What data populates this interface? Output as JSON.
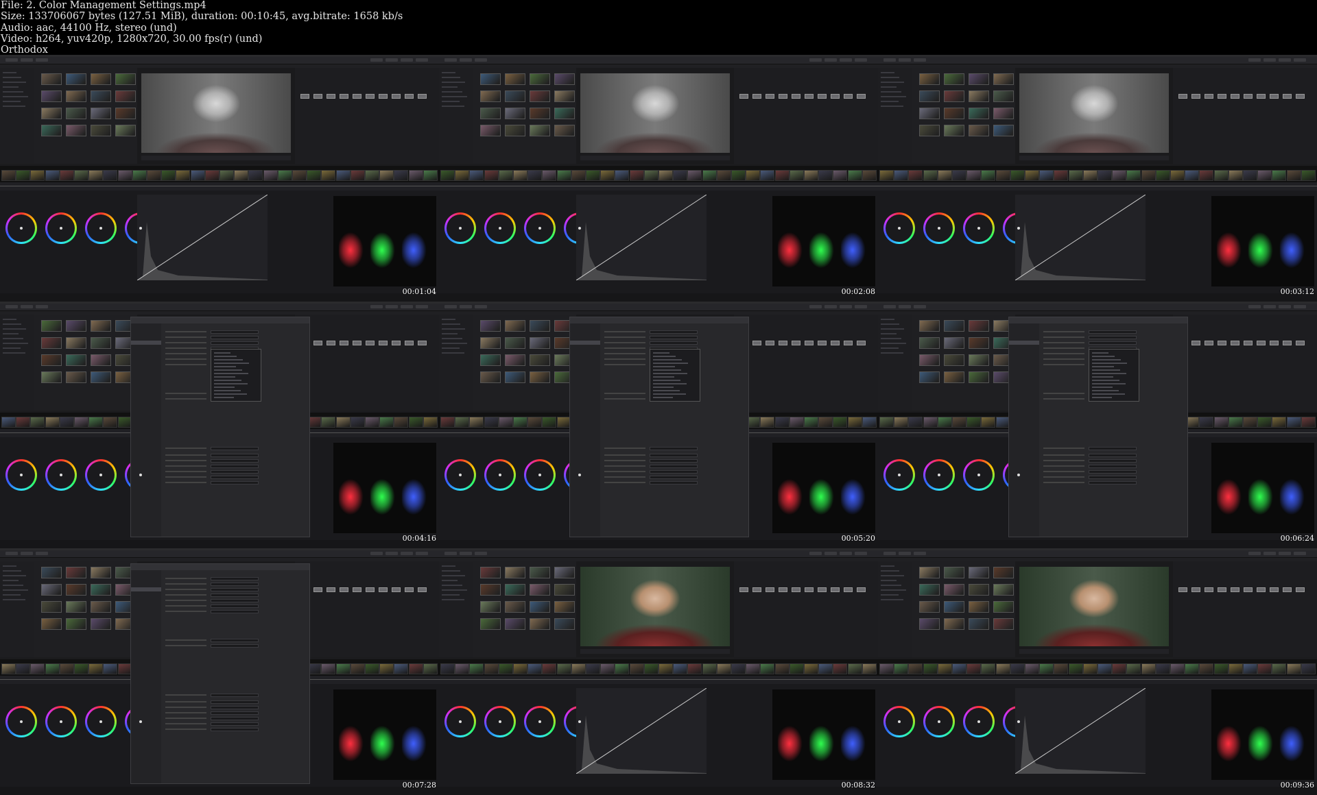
{
  "header": {
    "file": "File: 2. Color Management Settings.mp4",
    "size": "Size: 133706067 bytes (127.51 MiB), duration: 00:10:45, avg.bitrate: 1658 kb/s",
    "audio": "Audio: aac, 44100 Hz, stereo (und)",
    "video": "Video: h264, yuv420p, 1280x720, 30.00 fps(r) (und)",
    "source": "Orthodox"
  },
  "colors": {
    "background": "#000000",
    "header_text": "#e6e6e6",
    "ui_dark": "#1c1c1e",
    "scope_red": "#ff3040",
    "scope_green": "#30ff50",
    "scope_blue": "#4060ff"
  },
  "frames": [
    {
      "timestamp": "00:01:04",
      "state": "main",
      "viewer": "grey"
    },
    {
      "timestamp": "00:02:08",
      "state": "main",
      "viewer": "grey"
    },
    {
      "timestamp": "00:03:12",
      "state": "main",
      "viewer": "grey"
    },
    {
      "timestamp": "00:04:16",
      "state": "dialog",
      "viewer": "grey"
    },
    {
      "timestamp": "00:05:20",
      "state": "dialog",
      "viewer": "grey"
    },
    {
      "timestamp": "00:06:24",
      "state": "dialog",
      "viewer": "grey"
    },
    {
      "timestamp": "00:07:28",
      "state": "dialog",
      "viewer": "grey"
    },
    {
      "timestamp": "00:08:32",
      "state": "main",
      "viewer": "color"
    },
    {
      "timestamp": "00:09:36",
      "state": "main",
      "viewer": "color"
    }
  ]
}
